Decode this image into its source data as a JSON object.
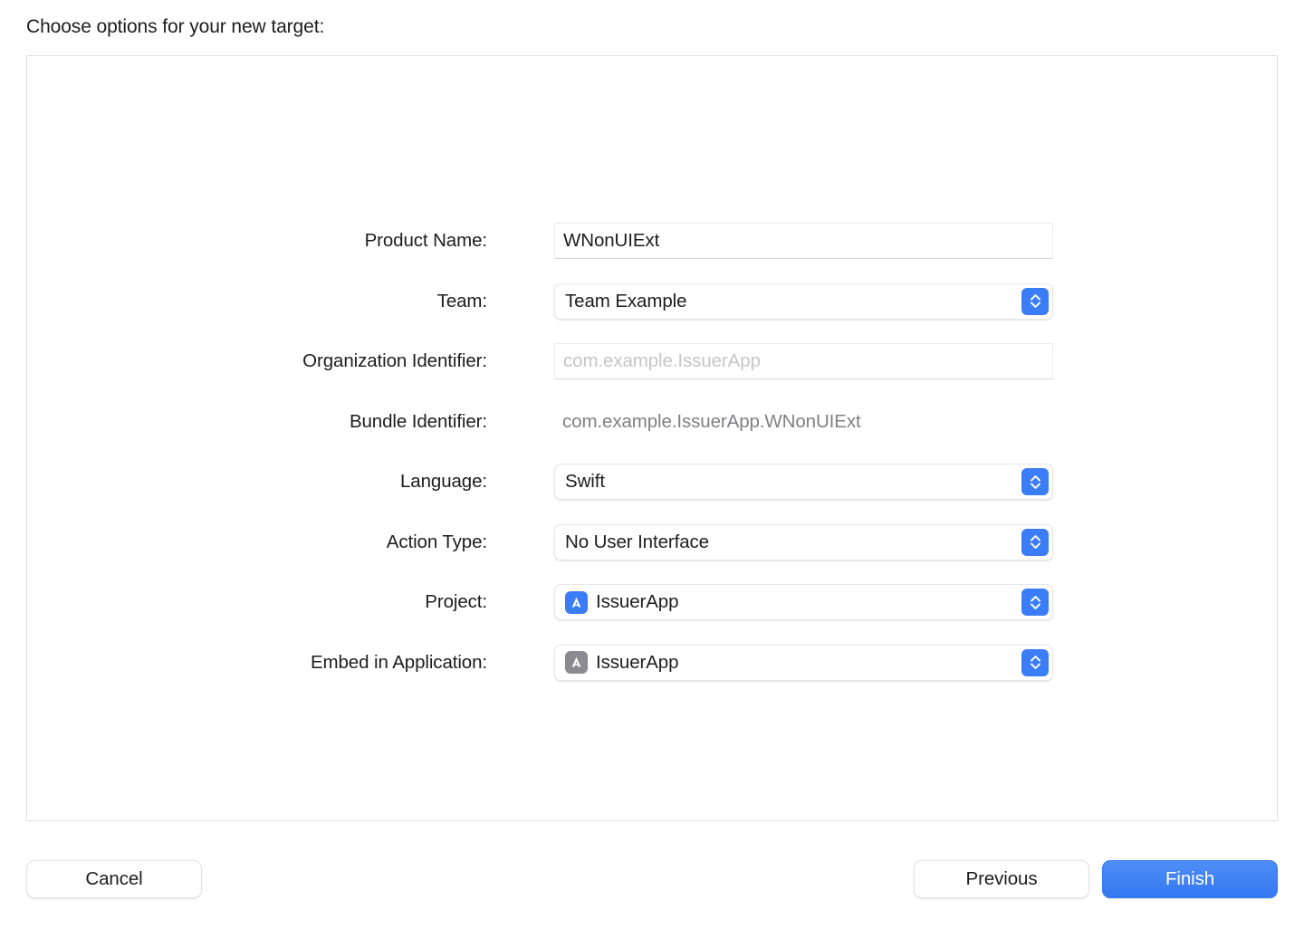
{
  "sheet": {
    "title": "Choose options for your new target:"
  },
  "form": {
    "rows": [
      {
        "name": "product-name",
        "label": "Product Name:",
        "type": "textfield",
        "value": "WNonUIExt",
        "placeholder": ""
      },
      {
        "name": "team",
        "label": "Team:",
        "type": "popup",
        "value": "Team Example"
      },
      {
        "name": "organization-identifier",
        "label": "Organization Identifier:",
        "type": "textfield",
        "value": "",
        "placeholder": "com.example.IssuerApp"
      },
      {
        "name": "bundle-identifier",
        "label": "Bundle Identifier:",
        "type": "static",
        "value": "com.example.IssuerApp.WNonUIExt"
      },
      {
        "name": "language",
        "label": "Language:",
        "type": "popup",
        "value": "Swift"
      },
      {
        "name": "action-type",
        "label": "Action Type:",
        "type": "popup",
        "value": "No User Interface"
      },
      {
        "name": "project",
        "label": "Project:",
        "type": "popup",
        "value": "IssuerApp",
        "icon": "xcode-project-icon",
        "icon_color": "#3b7df6"
      },
      {
        "name": "embed-in-application",
        "label": "Embed in Application:",
        "type": "popup",
        "value": "IssuerApp",
        "icon": "application-icon",
        "icon_color": "#8a8a8f"
      }
    ],
    "stepper_icon": "up-down-chevron-icon"
  },
  "footer": {
    "cancel_label": "Cancel",
    "previous_label": "Previous",
    "finish_label": "Finish"
  },
  "colors": {
    "accent": "#3b7df6",
    "primary_button": "#3578f0",
    "placeholder_text": "#c6c6c8",
    "static_text": "#808085",
    "panel_border": "#e2e2e4"
  }
}
